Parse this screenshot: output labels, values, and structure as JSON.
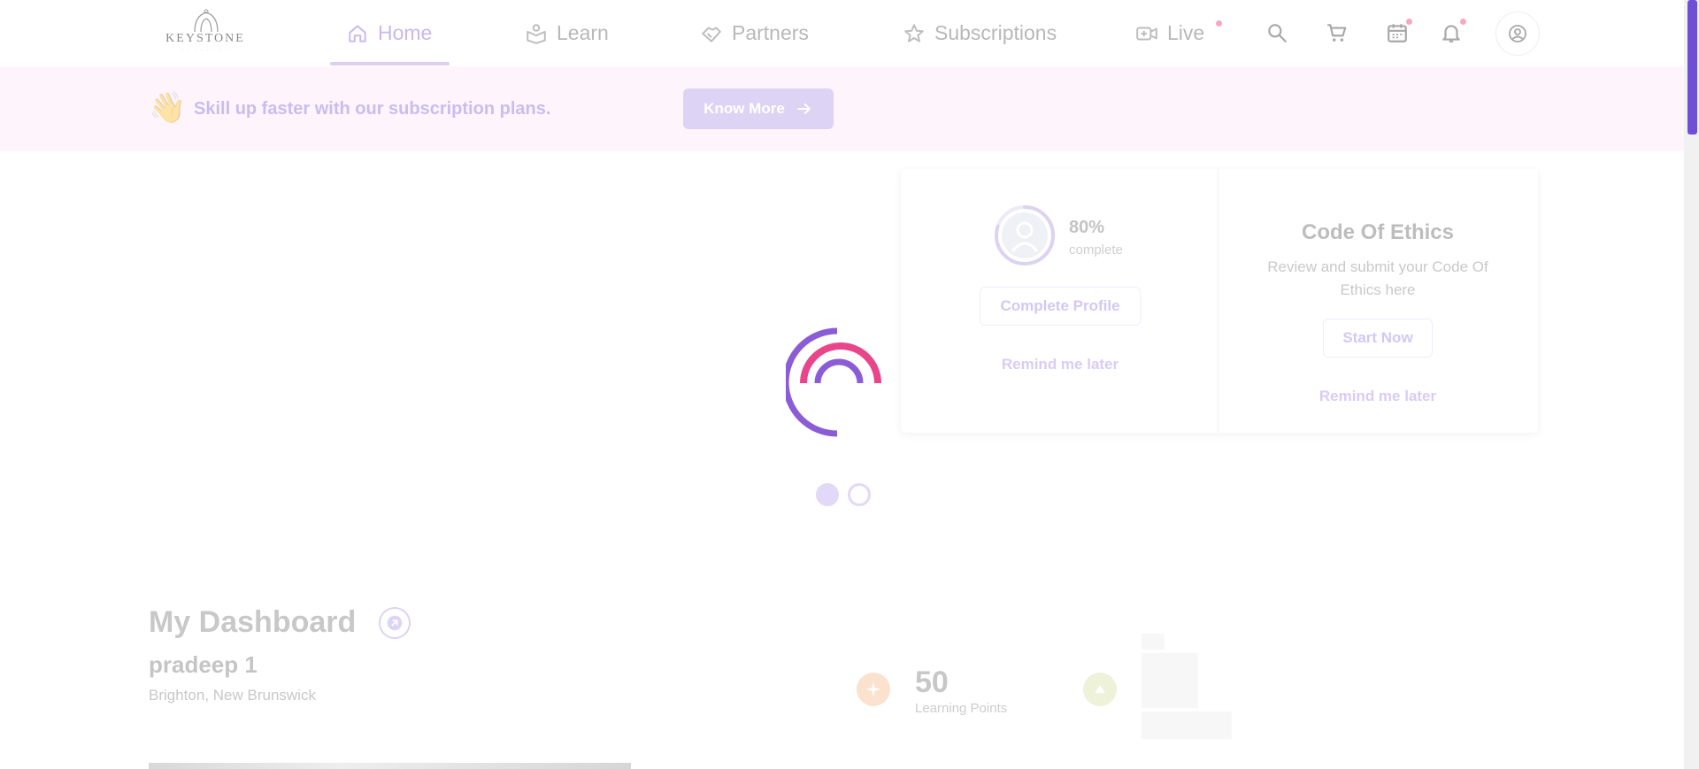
{
  "nav": {
    "logo_text": "KEYSTONE",
    "logo_sub": "· · · · · · · ·",
    "items": [
      {
        "label": "Home",
        "icon": "home-icon",
        "active": true
      },
      {
        "label": "Learn",
        "icon": "learn-icon",
        "active": false
      },
      {
        "label": "Partners",
        "icon": "partners-icon",
        "active": false
      },
      {
        "label": "Subscriptions",
        "icon": "star-icon",
        "active": false
      },
      {
        "label": "Live",
        "icon": "video-icon",
        "active": false
      }
    ],
    "icons": [
      "search-icon",
      "cart-icon",
      "calendar-icon",
      "bell-icon",
      "account-icon"
    ]
  },
  "banner": {
    "emoji": "👋",
    "text": "Skill up faster with our subscription plans.",
    "button": "Know More"
  },
  "profile_card": {
    "percent": "80%",
    "percent_label": "complete",
    "progress": 0.8,
    "button": "Complete Profile",
    "remind": "Remind me later"
  },
  "ethics_card": {
    "title": "Code Of Ethics",
    "description": "Review and submit your Code Of Ethics here",
    "button": "Start Now",
    "remind": "Remind me later"
  },
  "dashboard": {
    "title": "My Dashboard",
    "user_name": "pradeep 1",
    "location": "Brighton, New Brunswick",
    "points_value": "50",
    "points_label": "Learning Points"
  },
  "colors": {
    "accent": "#6f4fd6",
    "loader_purple": "#8a5cd6",
    "loader_pink": "#e8458a",
    "banner_bg": "#fdf5fb"
  }
}
